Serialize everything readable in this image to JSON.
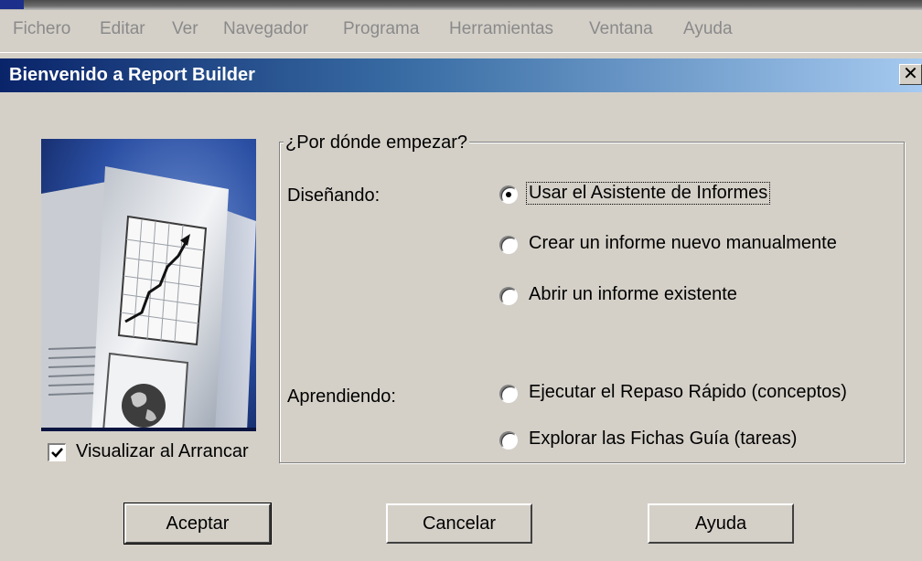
{
  "menu": [
    "Fichero",
    "Editar",
    "Ver",
    "Navegador",
    "Programa",
    "Herramientas",
    "Ventana",
    "Ayuda"
  ],
  "dialog": {
    "title": "Bienvenido a Report Builder",
    "close_symbol": "✕"
  },
  "startup_checkbox": {
    "label": "Visualizar al Arrancar",
    "checked": true,
    "mark": "✔"
  },
  "group": {
    "legend": "¿Por dónde empezar?",
    "sections": [
      {
        "label": "Diseñando:",
        "options": [
          {
            "label": "Usar el Asistente de Informes",
            "selected": true
          },
          {
            "label": "Crear un informe nuevo manualmente",
            "selected": false
          },
          {
            "label": "Abrir un informe existente",
            "selected": false
          }
        ]
      },
      {
        "label": "Aprendiendo:",
        "options": [
          {
            "label": "Ejecutar el Repaso Rápido (conceptos)",
            "selected": false
          },
          {
            "label": "Explorar las Fichas Guía (tareas)",
            "selected": false
          }
        ]
      }
    ]
  },
  "buttons": {
    "ok": "Aceptar",
    "cancel": "Cancelar",
    "help": "Ayuda"
  },
  "colors": {
    "dialog_bg": "#d4d0c8",
    "title_start": "#0a246a",
    "title_end": "#a6caf0"
  }
}
